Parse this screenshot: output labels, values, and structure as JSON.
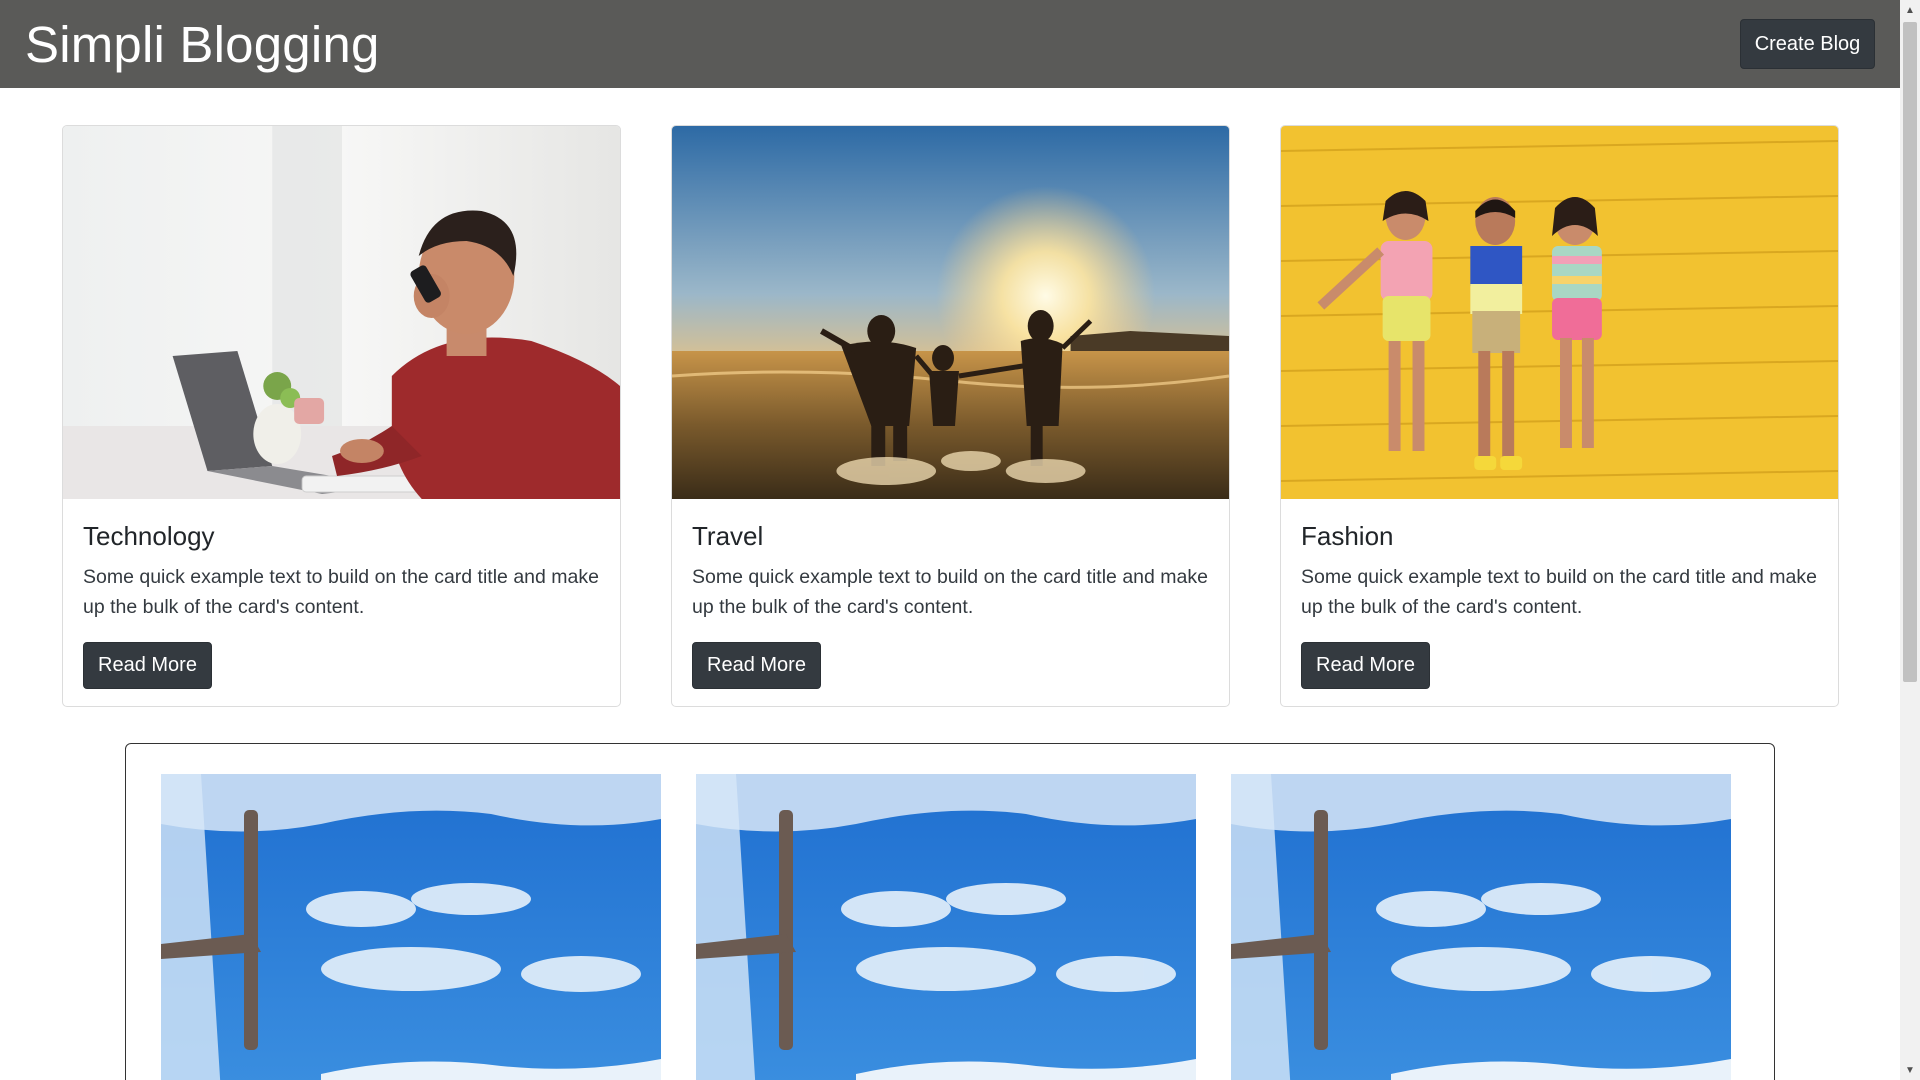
{
  "navbar": {
    "brand": "Simpli Blogging",
    "create_label": "Create Blog"
  },
  "cards": [
    {
      "title": "Technology",
      "text": "Some quick example text to build on the card title and make up the bulk of the card's content.",
      "button": "Read More"
    },
    {
      "title": "Travel",
      "text": "Some quick example text to build on the card title and make up the bulk of the card's content.",
      "button": "Read More"
    },
    {
      "title": "Fashion",
      "text": "Some quick example text to build on the card title and make up the bulk of the card's content.",
      "button": "Read More"
    }
  ],
  "colors": {
    "navbar_bg": "#5a5a58",
    "button_bg": "#343a40",
    "fashion_wall": "#f2c230",
    "sky_blue": "#2f87d8"
  },
  "icons": {
    "scroll_up": "scroll-up-arrow-icon",
    "scroll_down": "scroll-down-arrow-icon"
  }
}
